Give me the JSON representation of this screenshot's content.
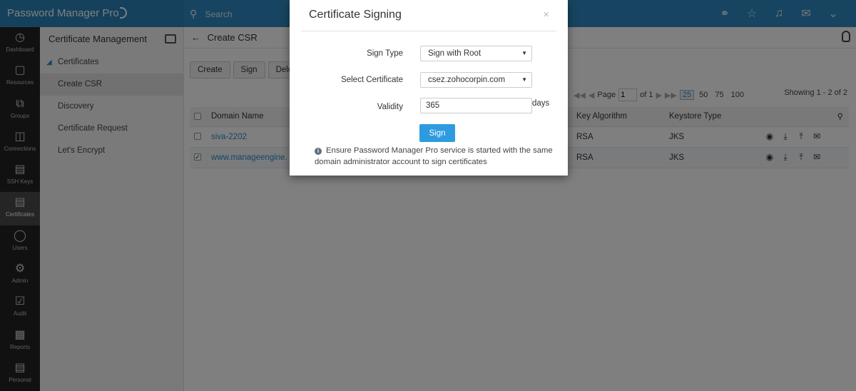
{
  "app": {
    "brand": "Password Manager Pro"
  },
  "topbar": {
    "search_placeholder": "Search",
    "icons": [
      "key-link-icon",
      "user-star-icon",
      "bell-icon",
      "mail-icon",
      "chevron-down-icon"
    ]
  },
  "leftnav": {
    "items": [
      {
        "label": "Dashboard",
        "icon": "dashboard-icon"
      },
      {
        "label": "Resources",
        "icon": "monitor-icon"
      },
      {
        "label": "Groups",
        "icon": "groups-icon"
      },
      {
        "label": "Connections",
        "icon": "connections-icon"
      },
      {
        "label": "SSH Keys",
        "icon": "ssh-key-icon"
      },
      {
        "label": "Certificates",
        "icon": "certificate-icon",
        "active": true
      },
      {
        "label": "Users",
        "icon": "user-icon"
      },
      {
        "label": "Admin",
        "icon": "gear-icon"
      },
      {
        "label": "Audit",
        "icon": "clipboard-icon"
      },
      {
        "label": "Reports",
        "icon": "bar-chart-icon"
      },
      {
        "label": "Personal",
        "icon": "personal-icon"
      }
    ]
  },
  "sidebar": {
    "title": "Certificate Management",
    "items": [
      {
        "label": "Certificates"
      },
      {
        "label": "Create CSR",
        "selected": true
      },
      {
        "label": "Discovery"
      },
      {
        "label": "Certificate Request"
      },
      {
        "label": "Let's Encrypt"
      }
    ]
  },
  "content": {
    "title": "Create CSR",
    "buttons": {
      "create": "Create",
      "sign": "Sign",
      "delete": "Delete"
    },
    "pager": {
      "page_label": "Page",
      "page_value": "1",
      "of_label": "of 1",
      "sizes": [
        "25",
        "50",
        "75",
        "100"
      ],
      "current_size": "25"
    },
    "showing": "Showing 1 - 2 of 2",
    "table": {
      "headers": {
        "domain": "Domain Name",
        "key_algorithm": "Key Algorithm",
        "keystore_type": "Keystore Type"
      },
      "rows": [
        {
          "domain": "siva-2202",
          "key_algorithm": "RSA",
          "keystore_type": "JKS",
          "checked": false
        },
        {
          "domain": "www.manageengine.",
          "key_algorithm": "RSA",
          "keystore_type": "JKS",
          "checked": true
        }
      ]
    }
  },
  "modal": {
    "title": "Certificate Signing",
    "close": "×",
    "sign_type_label": "Sign Type",
    "sign_type_value": "Sign with Root",
    "select_certificate_label": "Select Certificate",
    "select_certificate_value": "csez.zohocorpin.com",
    "validity_label": "Validity",
    "validity_value": "365",
    "validity_unit": "days",
    "sign_button": "Sign",
    "note": "Ensure Password Manager Pro service is started with the same domain administrator account to sign certificates"
  },
  "colors": {
    "topbar": "#2f8ac3",
    "nav_bg": "#232323",
    "sign_button": "#2e9be0",
    "link": "#2f8ac3"
  }
}
